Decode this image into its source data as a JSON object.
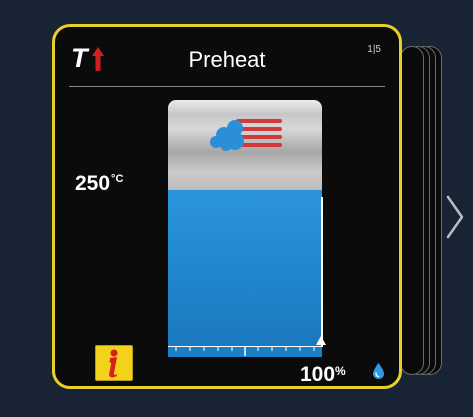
{
  "program": {
    "title": "Preheat",
    "page_indicator": "1|5",
    "mode_letter": "T"
  },
  "temperature": {
    "value": "250",
    "unit": "°C"
  },
  "humidity": {
    "value": "100",
    "unit": "%",
    "fill_fraction": 1.0
  },
  "icons": {
    "mode": "temperature-rising-icon",
    "chamber_graphic": "steam-icon",
    "info": "info-icon",
    "humidity": "water-drop-icon",
    "next": "chevron-right-icon"
  },
  "colors": {
    "accent": "#e8cf2a",
    "water": "#2287cf",
    "arrow_red": "#d01f1f",
    "background": "#182433"
  }
}
